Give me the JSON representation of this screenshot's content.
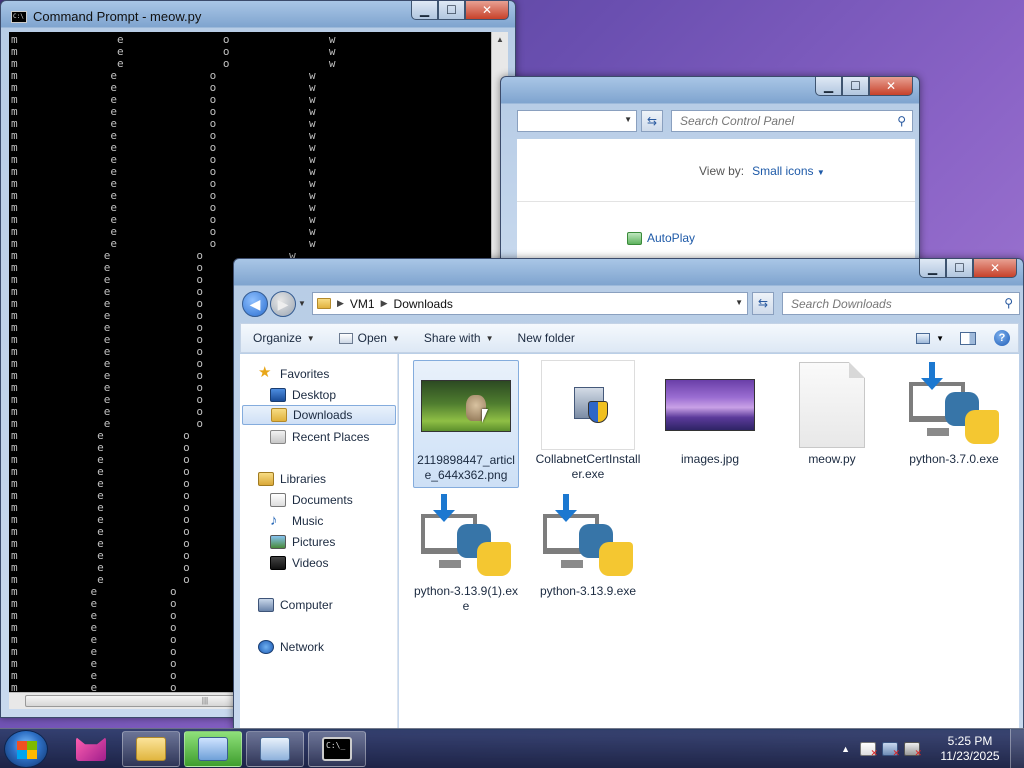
{
  "cmd_window": {
    "title": "Command Prompt - meow.py",
    "console_lines": [
      "m               e               o               w",
      "m               e               o               w",
      "m               e               o               w",
      "m              e              o              w",
      "m              e              o              w",
      "m              e              o              w",
      "m              e              o              w",
      "m              e              o              w",
      "m              e              o              w",
      "m              e              o              w",
      "m              e              o              w",
      "m              e              o              w",
      "m              e              o              w",
      "m              e              o              w",
      "m              e              o              w",
      "m              e              o              w",
      "m              e              o              w",
      "m              e              o              w",
      "m             e             o             w",
      "m             e             o             w",
      "m             e             o             w",
      "m             e             o             w",
      "m             e             o             w",
      "m             e             o             w",
      "m             e             o             w",
      "m             e             o             w",
      "m             e             o             w",
      "m             e             o             w",
      "m             e             o             w",
      "m             e             o             w",
      "m             e             o             w",
      "m             e             o             w",
      "m             e             o             w",
      "m            e            o            w",
      "m            e            o            w",
      "m            e            o            w",
      "m            e            o            w",
      "m            e            o            w",
      "m            e            o            w",
      "m            e            o            w",
      "m            e            o            w",
      "m            e            o            w",
      "m            e            o            w",
      "m            e            o            w",
      "m            e            o            w",
      "m            e            o            w",
      "m           e           o           w",
      "m           e           o           w",
      "m           e           o           w",
      "m           e           o           w",
      "m           e           o           w",
      "m           e           o           w",
      "m           e           o           w",
      "m           e           o           w",
      "m           e           o           w"
    ]
  },
  "control_panel": {
    "search_placeholder": "Search Control Panel",
    "view_by_label": "View by:",
    "view_by_value": "Small icons",
    "autoplay_label": "AutoPlay"
  },
  "explorer": {
    "breadcrumb": [
      "VM1",
      "Downloads"
    ],
    "search_placeholder": "Search Downloads",
    "toolbar": {
      "organize": "Organize",
      "open": "Open",
      "share_with": "Share with",
      "new_folder": "New folder"
    },
    "nav": {
      "favorites": "Favorites",
      "desktop": "Desktop",
      "downloads": "Downloads",
      "recent_places": "Recent Places",
      "libraries": "Libraries",
      "documents": "Documents",
      "music": "Music",
      "pictures": "Pictures",
      "videos": "Videos",
      "computer": "Computer",
      "network": "Network"
    },
    "files": [
      {
        "name": "2119898447_article_644x362.png",
        "icon": "cat-photo-thumbnail",
        "selected": true
      },
      {
        "name": "CollabnetCertInstaller.exe",
        "icon": "installer-shield-icon",
        "selected": false
      },
      {
        "name": "images.jpg",
        "icon": "purple-landscape-thumbnail",
        "selected": false
      },
      {
        "name": "meow.py",
        "icon": "blank-document-icon",
        "selected": false
      },
      {
        "name": "python-3.7.0.exe",
        "icon": "python-installer-icon",
        "selected": false
      },
      {
        "name": "python-3.13.9(1).exe",
        "icon": "python-installer-icon",
        "selected": false
      },
      {
        "name": "python-3.13.9.exe",
        "icon": "python-installer-icon",
        "selected": false
      }
    ]
  },
  "taskbar": {
    "time": "5:25 PM",
    "date": "11/23/2025"
  }
}
